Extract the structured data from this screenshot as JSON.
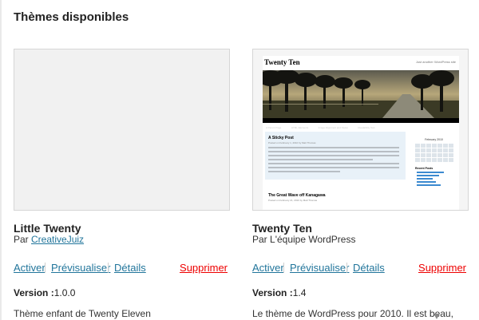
{
  "page": {
    "heading": "Thèmes disponibles"
  },
  "themes": [
    {
      "name": "Little Twenty",
      "author_prefix": "Par ",
      "author": "CreativeJuiz",
      "actions": {
        "activate": "Activer",
        "preview": "Prévisualiser",
        "details": "Détails",
        "delete": "Supprimer"
      },
      "version_label": "Version :",
      "version": "1.0.0",
      "description": "Thème enfant de Twenty Eleven"
    },
    {
      "name": "Twenty Ten",
      "author_prefix": "Par ",
      "author": "L'équipe WordPress",
      "actions": {
        "activate": "Activer",
        "preview": "Prévisualiser",
        "details": "Détails",
        "delete": "Supprimer"
      },
      "version_label": "Version :",
      "version": "1.4",
      "description": "Le thème de WordPress pour 2010. Il est beau,",
      "screenshot": {
        "site_title": "Twenty Ten",
        "tagline": "Just another WordPress site",
        "nav": [
          "A Parent Page",
          "HTML Elements",
          "Image Alignment and Styles",
          "Readability Test"
        ],
        "post_title": "A Sticky Post",
        "post_meta": "Posted on February 1, 2010 by Matt Thomas",
        "post2_title": "The Great Wave off Kanagawa",
        "post2_meta": "Posted on February 21, 2010 by Matt Thomas",
        "calendar_title": "February 2010",
        "sidebar_heading": "Recent Posts"
      }
    }
  ],
  "colors": {
    "link": "#21759b",
    "delete": "#e00000",
    "separator": "#d0d0d0"
  }
}
